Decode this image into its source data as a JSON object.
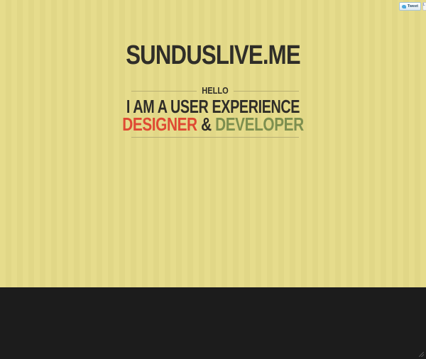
{
  "social": {
    "tweet_label": "Tweet",
    "like_label": "L"
  },
  "header": {
    "site_title": "SUNDUSLIVE.ME"
  },
  "intro": {
    "greeting": "HELLO",
    "line1": "I AM A USER EXPERIENCE",
    "designer": "DESIGNER",
    "ampersand": "&",
    "developer": "DEVELOPER"
  },
  "colors": {
    "background": "#e6dc8c",
    "stripe": "#e1d787",
    "text": "#2f2d28",
    "designer": "#df4a33",
    "developer": "#7d8f4f",
    "footer": "#1c1c1c"
  }
}
